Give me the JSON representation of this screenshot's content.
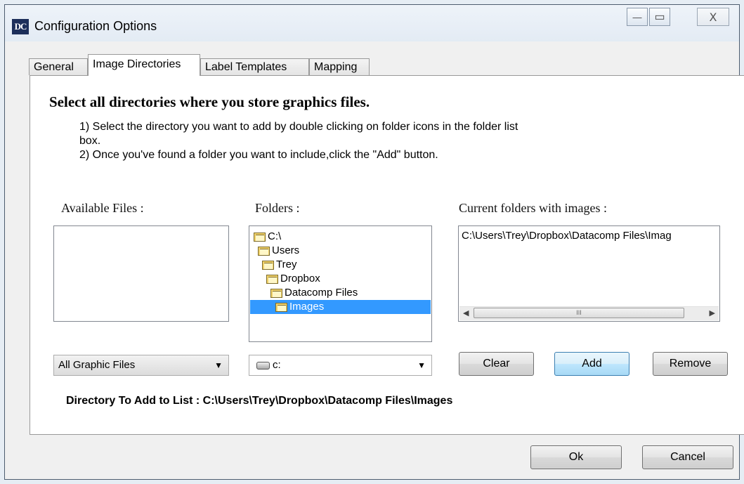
{
  "window": {
    "title": "Configuration Options",
    "icon_text": "DC",
    "minimize_glyph": "—",
    "maximize_glyph": "▭",
    "close_glyph": "X"
  },
  "tabs": [
    {
      "label": "General",
      "active": false
    },
    {
      "label": "Image Directories",
      "active": true
    },
    {
      "label": "Label Templates",
      "active": false
    },
    {
      "label": "Mapping",
      "active": false
    }
  ],
  "content": {
    "heading": "Select all directories where you store graphics files.",
    "instruction_1a": "1) Select the directory you want to add by double clicking on folder icons in the folder list",
    "instruction_1b": "box.",
    "instruction_2": "2) Once you've found a folder you want to include,click the \"Add\" button."
  },
  "available_files": {
    "label": "Available Files :",
    "items": [],
    "filter_value": "All Graphic Files",
    "dropdown_icon": "dropdown-arrow"
  },
  "folders": {
    "label": "Folders :",
    "items": [
      {
        "name": "C:\\",
        "level": 0,
        "selected": false
      },
      {
        "name": "Users",
        "level": 1,
        "selected": false
      },
      {
        "name": "Trey",
        "level": 2,
        "selected": false
      },
      {
        "name": "Dropbox",
        "level": 3,
        "selected": false
      },
      {
        "name": "Datacomp Files",
        "level": 4,
        "selected": false
      },
      {
        "name": "Images",
        "level": 5,
        "selected": true
      }
    ],
    "drive_value": "c:",
    "drive_icon": "drive-icon"
  },
  "current_folders": {
    "label": "Current folders with images :",
    "items": [
      "C:\\Users\\Trey\\Dropbox\\Datacomp Files\\Imag"
    ],
    "scroll_left": "◀",
    "scroll_right": "▶",
    "scroll_grip": "III"
  },
  "buttons": {
    "clear": "Clear",
    "add": "Add",
    "remove": "Remove",
    "ok": "Ok",
    "cancel": "Cancel"
  },
  "directory_to_add": "Directory To Add to List : C:\\Users\\Trey\\Dropbox\\Datacomp Files\\Images",
  "colors": {
    "selection": "#3399ff",
    "title_icon_bg": "#1d2f5a"
  }
}
